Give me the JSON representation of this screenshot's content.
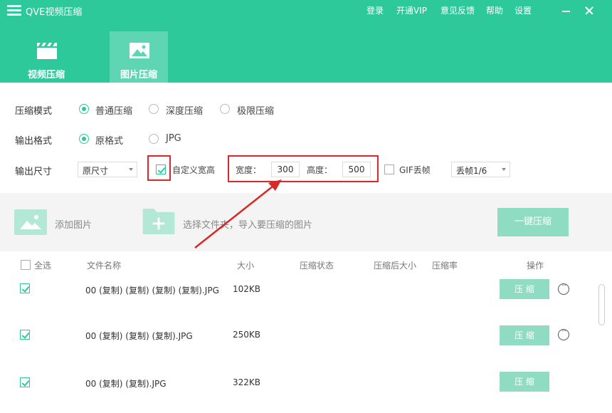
{
  "app": {
    "title": "QVE视频压缩"
  },
  "titlebar": {
    "menus": [
      "登录",
      "开通VIP",
      "意见反馈",
      "帮助",
      "设置"
    ]
  },
  "tabs": [
    {
      "label": "视频压缩",
      "active": false
    },
    {
      "label": "图片压缩",
      "active": true
    }
  ],
  "options": {
    "mode": {
      "label": "压缩模式",
      "choices": [
        "普通压缩",
        "深度压缩",
        "极限压缩"
      ],
      "selected": "普通压缩"
    },
    "format": {
      "label": "输出格式",
      "choices": [
        "原格式",
        "JPG"
      ],
      "selected": "原格式"
    },
    "size": {
      "label": "输出尺寸",
      "select_value": "原尺寸",
      "custom_label": "自定义宽高",
      "custom_checked": true,
      "width_label": "宽度：",
      "width_value": "300",
      "height_label": "高度：",
      "height_value": "500",
      "gif_label": "GIF丢帧",
      "gif_checked": false,
      "gif_select": "丢帧1/6"
    }
  },
  "add_area": {
    "add_image": "添加图片",
    "select_folder": "选择文件夹，导入要压缩的图片",
    "compress_all": "一键压缩"
  },
  "table": {
    "select_all": "全选",
    "headers": [
      "文件名称",
      "大小",
      "压缩状态",
      "压缩后大小",
      "压缩率",
      "操作"
    ],
    "rows": [
      {
        "name": "00 (复制) (复制) (复制) (复制).JPG",
        "size": "102KB",
        "checked": true
      },
      {
        "name": "00 (复制) (复制) (复制).JPG",
        "size": "250KB",
        "checked": true
      },
      {
        "name": "00 (复制) (复制).JPG",
        "size": "322KB",
        "checked": true
      }
    ],
    "action_label": "压 缩"
  },
  "colors": {
    "brand": "#2ec99a",
    "button": "#8fdcc2",
    "highlight": "#e0252a"
  }
}
